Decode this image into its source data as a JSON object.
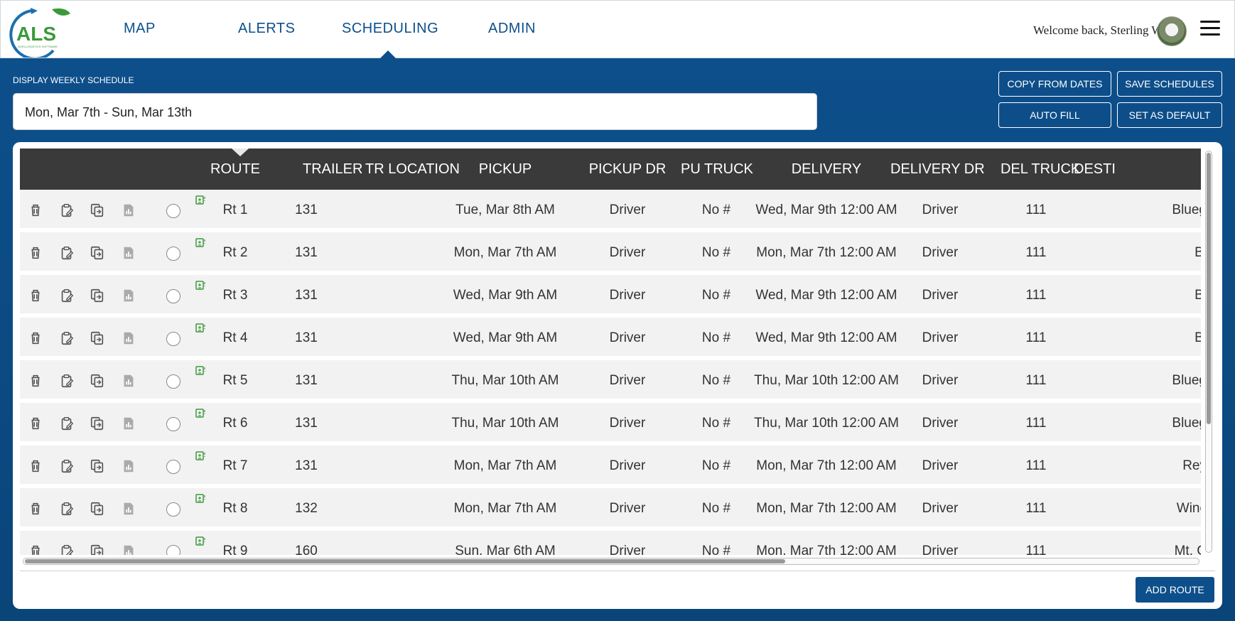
{
  "nav": {
    "logo_text": "ALS",
    "logo_tagline": "AGRI-LOGISTICS SOFTWARE",
    "items": [
      "MAP",
      "ALERTS",
      "SCHEDULING",
      "ADMIN"
    ],
    "active": "SCHEDULING",
    "welcome": "Welcome back, Sterling W."
  },
  "schedule": {
    "label": "DISPLAY WEEKLY SCHEDULE",
    "range": "Mon, Mar 7th - Sun, Mar 13th"
  },
  "actions": {
    "copy_from_dates": "COPY FROM DATES",
    "save_schedules": "SAVE SCHEDULES",
    "auto_fill": "AUTO FILL",
    "set_as_default": "SET AS DEFAULT",
    "add_route": "ADD ROUTE"
  },
  "table": {
    "headers": [
      "ROUTE",
      "TRAILER",
      "TR LOCATION",
      "PICKUP",
      "PICKUP DR",
      "PU TRUCK",
      "DELIVERY",
      "DELIVERY DR",
      "DEL TRUCK",
      "DESTI"
    ],
    "rows": [
      {
        "route": "Rt 1",
        "trailer": "131",
        "pickup": "Tue, Mar 8th AM",
        "pickup_dr": "Driver",
        "pu_truck": "No #",
        "delivery": "Wed, Mar 9th 12:00 AM",
        "delivery_dr": "Driver",
        "del_truck": "111",
        "dest": "Blueg"
      },
      {
        "route": "Rt 2",
        "trailer": "131",
        "pickup": "Mon, Mar 7th AM",
        "pickup_dr": "Driver",
        "pu_truck": "No #",
        "delivery": "Mon, Mar 7th 12:00 AM",
        "delivery_dr": "Driver",
        "del_truck": "111",
        "dest": "Bi"
      },
      {
        "route": "Rt 3",
        "trailer": "131",
        "pickup": "Wed, Mar 9th AM",
        "pickup_dr": "Driver",
        "pu_truck": "No #",
        "delivery": "Wed, Mar 9th 12:00 AM",
        "delivery_dr": "Driver",
        "del_truck": "111",
        "dest": "Bi"
      },
      {
        "route": "Rt 4",
        "trailer": "131",
        "pickup": "Wed, Mar 9th AM",
        "pickup_dr": "Driver",
        "pu_truck": "No #",
        "delivery": "Wed, Mar 9th 12:00 AM",
        "delivery_dr": "Driver",
        "del_truck": "111",
        "dest": "Bi"
      },
      {
        "route": "Rt 5",
        "trailer": "131",
        "pickup": "Thu, Mar 10th AM",
        "pickup_dr": "Driver",
        "pu_truck": "No #",
        "delivery": "Thu, Mar 10th 12:00 AM",
        "delivery_dr": "Driver",
        "del_truck": "111",
        "dest": "Blueg"
      },
      {
        "route": "Rt 6",
        "trailer": "131",
        "pickup": "Thu, Mar 10th AM",
        "pickup_dr": "Driver",
        "pu_truck": "No #",
        "delivery": "Thu, Mar 10th 12:00 AM",
        "delivery_dr": "Driver",
        "del_truck": "111",
        "dest": "Blueg"
      },
      {
        "route": "Rt 7",
        "trailer": "131",
        "pickup": "Mon, Mar 7th AM",
        "pickup_dr": "Driver",
        "pu_truck": "No #",
        "delivery": "Mon, Mar 7th 12:00 AM",
        "delivery_dr": "Driver",
        "del_truck": "111",
        "dest": "Rey"
      },
      {
        "route": "Rt 8",
        "trailer": "132",
        "pickup": "Mon, Mar 7th AM",
        "pickup_dr": "Driver",
        "pu_truck": "No #",
        "delivery": "Mon, Mar 7th 12:00 AM",
        "delivery_dr": "Driver",
        "del_truck": "111",
        "dest": "Winc"
      },
      {
        "route": "Rt 9",
        "trailer": "160",
        "pickup": "Sun, Mar 6th AM",
        "pickup_dr": "Driver",
        "pu_truck": "No #",
        "delivery": "Mon, Mar 7th 12:00 AM",
        "delivery_dr": "Driver",
        "del_truck": "111",
        "dest": "Mt. C"
      }
    ]
  },
  "colors": {
    "brand_blue": "#0d4f8b",
    "header_dark": "#3a3a3a",
    "row_bg": "#f2f2f2",
    "logo_green": "#3a9a3a"
  }
}
